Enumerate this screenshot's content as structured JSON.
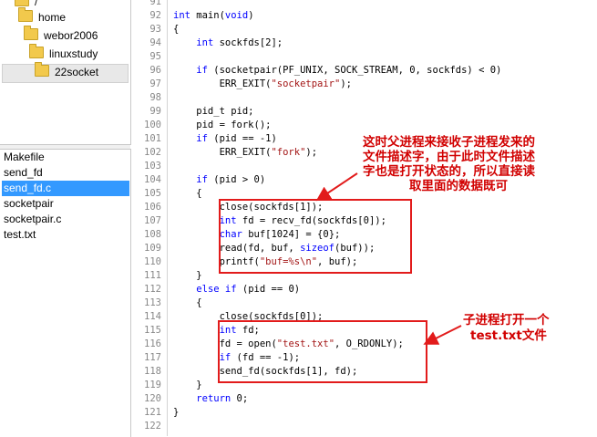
{
  "tree": {
    "items": [
      {
        "label": "/",
        "indent": 0
      },
      {
        "label": "home",
        "indent": 1
      },
      {
        "label": "webor2006",
        "indent": 2
      },
      {
        "label": "linuxstudy",
        "indent": 3
      },
      {
        "label": "22socket",
        "indent": 4,
        "selected": true
      }
    ]
  },
  "files": {
    "items": [
      {
        "label": "Makefile"
      },
      {
        "label": "send_fd"
      },
      {
        "label": "send_fd.c",
        "selected": true
      },
      {
        "label": "socketpair"
      },
      {
        "label": "socketpair.c"
      },
      {
        "label": "test.txt"
      }
    ]
  },
  "editor": {
    "line_numbers": [
      "91",
      "92",
      "93",
      "94",
      "95",
      "96",
      "97",
      "98",
      "99",
      "100",
      "101",
      "102",
      "103",
      "104",
      "105",
      "106",
      "107",
      "108",
      "109",
      "110",
      "111",
      "112",
      "113",
      "114",
      "115",
      "116",
      "117",
      "118",
      "119",
      "120",
      "121",
      "122"
    ],
    "lines": [
      "",
      "int main(void)",
      "{",
      "    int sockfds[2];",
      "",
      "    if (socketpair(PF_UNIX, SOCK_STREAM, 0, sockfds) < 0)",
      "        ERR_EXIT(\"socketpair\");",
      "",
      "    pid_t pid;",
      "    pid = fork();",
      "    if (pid == -1)",
      "        ERR_EXIT(\"fork\");",
      "",
      "    if (pid > 0)",
      "    {",
      "        close(sockfds[1]);",
      "        int fd = recv_fd(sockfds[0]);",
      "        char buf[1024] = {0};",
      "        read(fd, buf, sizeof(buf));",
      "        printf(\"buf=%s\\n\", buf);",
      "    }",
      "    else if (pid == 0)",
      "    {",
      "        close(sockfds[0]);",
      "        int fd;",
      "        fd = open(\"test.txt\", O_RDONLY);",
      "        if (fd == -1);",
      "        send_fd(sockfds[1], fd);",
      "    }",
      "    return 0;",
      "}",
      ""
    ]
  },
  "annotations": {
    "parent_note": [
      "这时父进程来接收子进程发来的",
      "文件描述字，由于此时文件描述",
      "字也是打开状态的，所以直接读",
      "取里面的数据既可"
    ],
    "child_note": [
      "子进程打开一个",
      "test.txt文件"
    ]
  },
  "colors": {
    "keyword": "#0000ff",
    "string": "#a31515",
    "annotation_red": "#e21b1b",
    "selection_blue": "#3399ff"
  }
}
